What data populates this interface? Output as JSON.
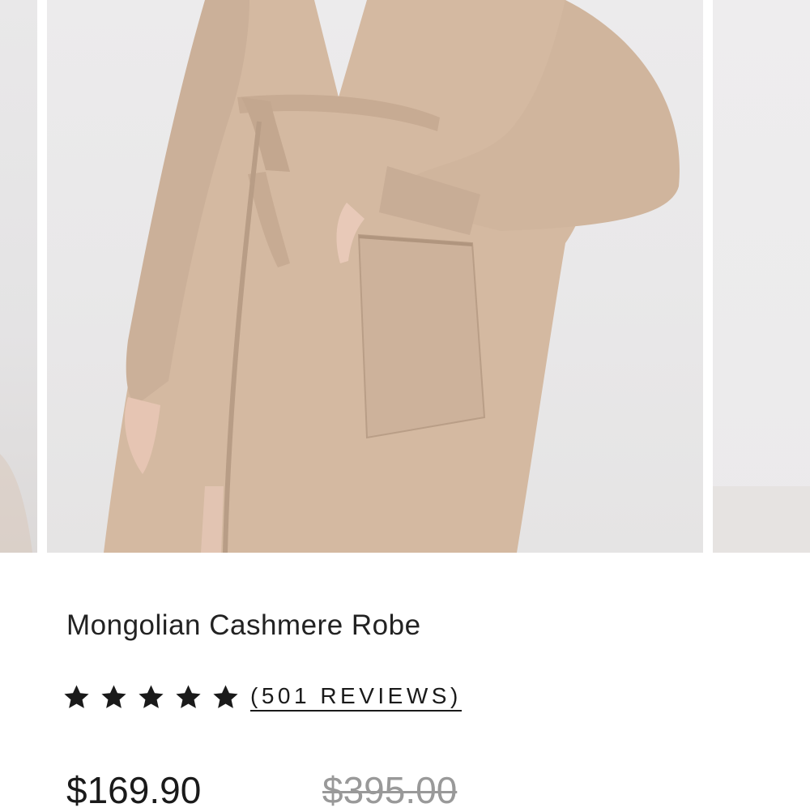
{
  "gallery": {
    "images": [
      {
        "icon": "robe-photo-previous"
      },
      {
        "icon": "robe-photo-main"
      },
      {
        "icon": "robe-photo-next"
      }
    ]
  },
  "product": {
    "title": "Mongolian Cashmere Robe",
    "rating": {
      "stars": 5,
      "reviews_label": "(501 REVIEWS)"
    },
    "price": "$169.90",
    "compare_at_price": "$395.00"
  },
  "colors": {
    "text": "#1a1a1a",
    "strikethrough_price": "#999999",
    "robe": "#d4b9a1"
  }
}
